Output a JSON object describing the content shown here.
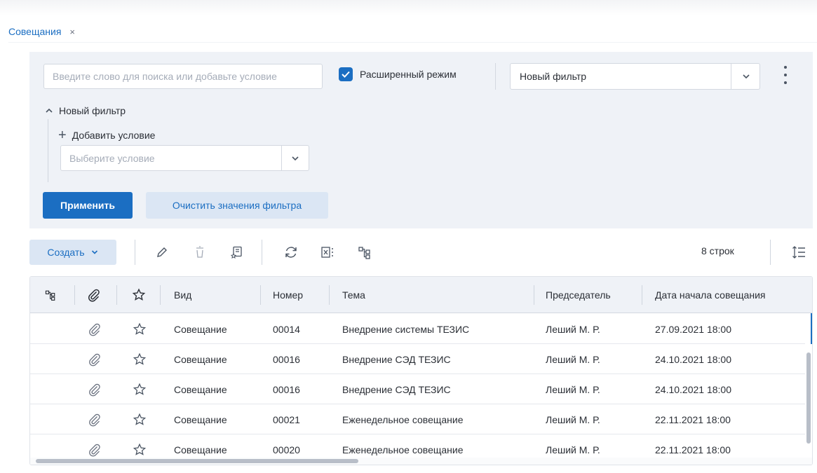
{
  "tab": {
    "title": "Совещания",
    "close": "×"
  },
  "filter": {
    "search_placeholder": "Введите слово для поиска или добавьте условие",
    "advanced_mode_label": "Расширенный режим",
    "advanced_mode_checked": true,
    "selected_filter": "Новый фильтр",
    "group_title": "Новый фильтр",
    "add_condition_label": "Добавить условие",
    "condition_placeholder": "Выберите условие",
    "apply_label": "Применить",
    "clear_label": "Очистить значения фильтра"
  },
  "toolbar": {
    "create_label": "Создать",
    "rows_count": "8 строк",
    "icons": [
      "edit-icon",
      "delete-icon",
      "add-to-favorites-icon",
      "refresh-icon",
      "excel-export-icon",
      "hierarchy-icon",
      "row-height-icon"
    ]
  },
  "table": {
    "columns": [
      "Вид",
      "Номер",
      "Тема",
      "Председатель",
      "Дата начала совещания"
    ],
    "rows": [
      {
        "type": "Совещание",
        "number": "00014",
        "topic": "Внедрение системы ТЕЗИС",
        "chair": "Леший М. Р.",
        "date": "27.09.2021 18:00"
      },
      {
        "type": "Совещание",
        "number": "00016",
        "topic": "Внедрение СЭД ТЕЗИС",
        "chair": "Леший М. Р.",
        "date": "24.10.2021 18:00"
      },
      {
        "type": "Совещание",
        "number": "00016",
        "topic": "Внедрение СЭД ТЕЗИС",
        "chair": "Леший М. Р.",
        "date": "24.10.2021 18:00"
      },
      {
        "type": "Совещание",
        "number": "00021",
        "topic": "Еженедельное совещание",
        "chair": "Леший М. Р.",
        "date": "22.11.2021 18:00"
      },
      {
        "type": "Совещание",
        "number": "00020",
        "topic": "Еженедельное совещание",
        "chair": "Леший М. Р.",
        "date": "22.11.2021 18:00"
      }
    ]
  },
  "colors": {
    "accent": "#1b6ec2",
    "panel_bg": "#eff2f7",
    "secondary_btn_bg": "#dbe6f4"
  }
}
